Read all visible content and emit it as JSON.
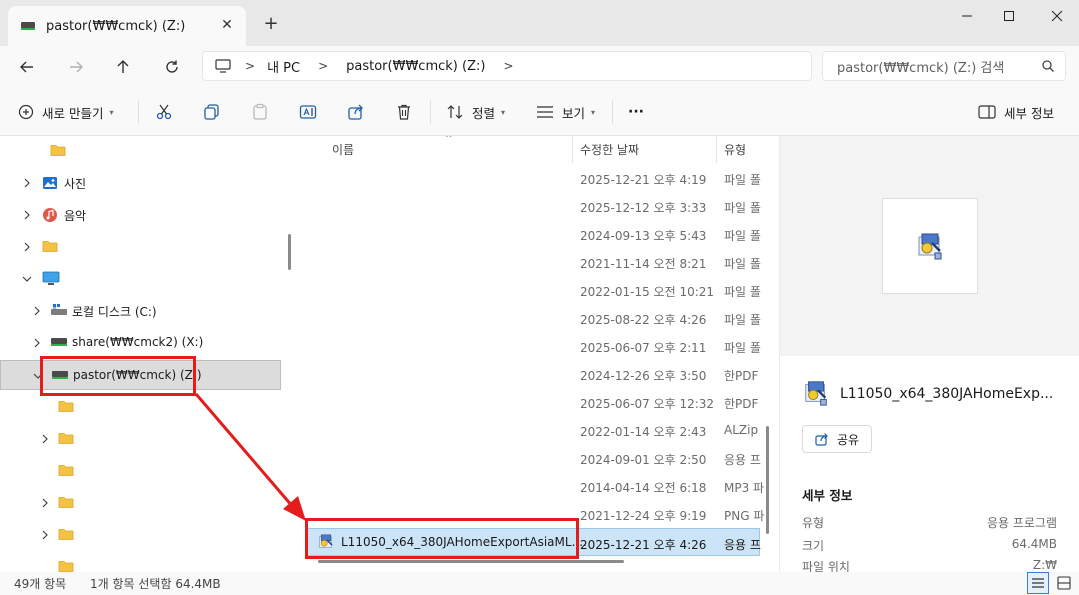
{
  "window": {
    "tab_title": "pastor(₩₩cmck) (Z:)",
    "tab_close_glyph": "✕",
    "new_tab_glyph": "+"
  },
  "address": {
    "crumbs": [
      "내 PC",
      "pastor(₩₩cmck) (Z:)"
    ],
    "search_placeholder": "pastor(₩₩cmck) (Z:) 검색"
  },
  "toolbar": {
    "new_label": "새로 만들기",
    "sort_label": "정렬",
    "view_label": "보기",
    "more_label": "···",
    "details_label": "세부 정보"
  },
  "nav_tree": {
    "items": [
      {
        "label": "",
        "icon": "folder-icon",
        "expand": "none"
      },
      {
        "label": "사진",
        "icon": "pictures-icon",
        "expand": "collapsed"
      },
      {
        "label": "음악",
        "icon": "music-icon",
        "expand": "collapsed"
      },
      {
        "label": "",
        "icon": "folder-icon",
        "expand": "collapsed"
      },
      {
        "label": "",
        "icon": "pc-icon",
        "expand": "expanded"
      },
      {
        "label": "로컬 디스크 (C:)",
        "icon": "windows-drive-icon",
        "expand": "collapsed"
      },
      {
        "label": "share(₩₩cmck2) (X:)",
        "icon": "network-drive-icon",
        "expand": "collapsed"
      },
      {
        "label": "pastor(₩₩cmck) (Z:)",
        "icon": "network-drive-icon",
        "expand": "expanded",
        "selected": true
      },
      {
        "label": "",
        "icon": "folder-icon",
        "expand": "none"
      },
      {
        "label": "",
        "icon": "folder-icon",
        "expand": "collapsed"
      },
      {
        "label": "",
        "icon": "folder-icon",
        "expand": "none"
      },
      {
        "label": "",
        "icon": "folder-icon",
        "expand": "collapsed"
      },
      {
        "label": "",
        "icon": "folder-icon",
        "expand": "collapsed"
      },
      {
        "label": "",
        "icon": "folder-icon",
        "expand": "none"
      }
    ]
  },
  "file_list": {
    "columns": [
      "이름",
      "수정한 날짜",
      "유형"
    ],
    "rows": [
      {
        "name": "",
        "date": "2025-12-21 오후 4:19",
        "type": "파일 폴"
      },
      {
        "name": "",
        "date": "2025-12-12 오후 3:33",
        "type": "파일 폴"
      },
      {
        "name": "",
        "date": "2024-09-13 오후 5:43",
        "type": "파일 폴"
      },
      {
        "name": "",
        "date": "2021-11-14 오전 8:21",
        "type": "파일 폴"
      },
      {
        "name": "",
        "date": "2022-01-15 오전 10:21",
        "type": "파일 폴"
      },
      {
        "name": "",
        "date": "2025-08-22 오후 4:26",
        "type": "파일 폴"
      },
      {
        "name": "",
        "date": "2025-06-07 오후 2:11",
        "type": "파일 폴"
      },
      {
        "name": "",
        "date": "2024-12-26 오후 3:50",
        "type": "한PDF"
      },
      {
        "name": "",
        "date": "2025-06-07 오후 12:32",
        "type": "한PDF"
      },
      {
        "name": "",
        "date": "2022-01-14 오후 2:43",
        "type": "ALZip"
      },
      {
        "name": "",
        "date": "2024-09-01 오후 2:50",
        "type": "응용 프"
      },
      {
        "name": "",
        "date": "2014-04-14 오전 6:18",
        "type": "MP3 파"
      },
      {
        "name": "",
        "date": "2021-12-24 오후 9:19",
        "type": "PNG 파"
      },
      {
        "name": "L11050_x64_380JAHomeExportAsiaML....",
        "date": "2025-12-21 오후 4:26",
        "type": "응용 프",
        "selected": true
      }
    ]
  },
  "details": {
    "filename": "L11050_x64_380JAHomeExp...",
    "share_label": "공유",
    "section_title": "세부 정보",
    "props": [
      {
        "key": "유형",
        "value": "응용 프로그램"
      },
      {
        "key": "크기",
        "value": "64.4MB"
      },
      {
        "key": "파일 위치",
        "value": "Z:₩"
      }
    ]
  },
  "status": {
    "item_count": "49개 항목",
    "selection": "1개 항목 선택함 64.4MB"
  },
  "colors": {
    "annotation": "#e51c1c",
    "selection_bg": "#cce4f7",
    "folder": "#f5c242"
  }
}
